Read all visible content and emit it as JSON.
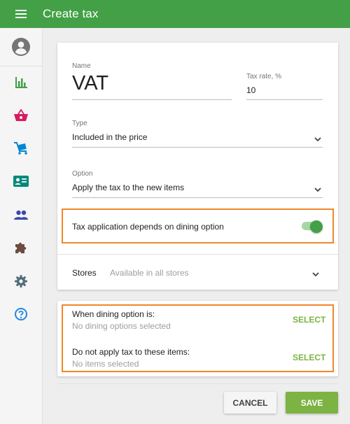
{
  "header": {
    "title": "Create tax",
    "icon": "hamburger-menu-icon"
  },
  "sidebar": {
    "avatar_icon": "account-circle-icon",
    "items": [
      {
        "name": "reports",
        "icon": "bar-chart-icon",
        "color": "#43a047"
      },
      {
        "name": "sales",
        "icon": "basket-icon",
        "color": "#d81b60"
      },
      {
        "name": "items",
        "icon": "cart-icon",
        "color": "#0288d1"
      },
      {
        "name": "employees",
        "icon": "id-card-icon",
        "color": "#00897b"
      },
      {
        "name": "customers",
        "icon": "people-icon",
        "color": "#3949ab"
      },
      {
        "name": "integrations",
        "icon": "puzzle-icon",
        "color": "#6d4c41"
      },
      {
        "name": "settings",
        "icon": "gear-icon",
        "color": "#546e7a"
      },
      {
        "name": "help",
        "icon": "help-circle-icon",
        "color": "#1e88e5"
      }
    ]
  },
  "form": {
    "name_label": "Name",
    "name_value": "VAT",
    "rate_label": "Tax rate, %",
    "rate_value": "10",
    "type_label": "Type",
    "type_value": "Included in the price",
    "option_label": "Option",
    "option_value": "Apply the tax to the new items",
    "dining_toggle_label": "Tax application depends on dining option",
    "dining_toggle_on": true,
    "stores_label": "Stores",
    "stores_value": "Available in all stores"
  },
  "dining": {
    "when_title": "When dining option is:",
    "when_sub": "No dining options selected",
    "when_action": "SELECT",
    "exclude_title": "Do not apply tax to these items:",
    "exclude_sub": "No items selected",
    "exclude_action": "SELECT"
  },
  "actions": {
    "cancel": "CANCEL",
    "save": "SAVE"
  },
  "colors": {
    "primary": "#43a047",
    "accent": "#7cb342",
    "highlight": "#f0862b"
  }
}
